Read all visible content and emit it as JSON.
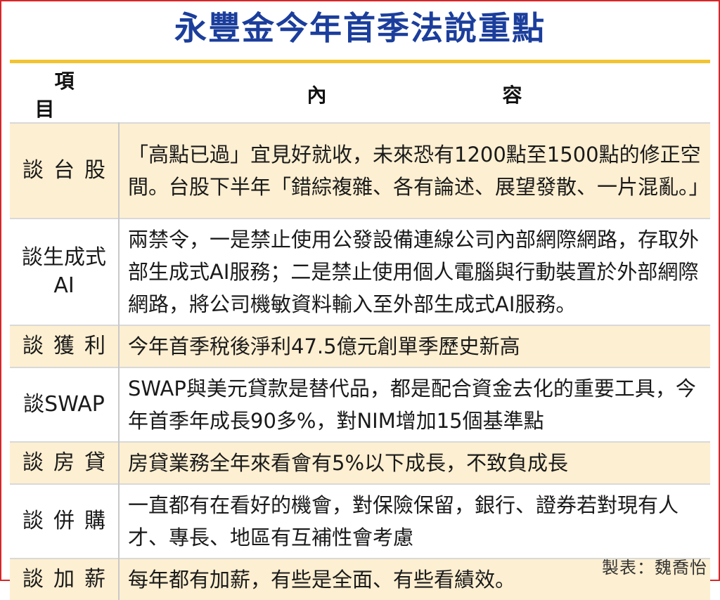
{
  "title": "永豐金今年首季法說重點",
  "header": {
    "item": "項目",
    "content": "內容"
  },
  "rows": [
    {
      "item": "談台股",
      "content": "「高點已過」宜見好就收，未來恐有1200點至1500點的修正空間。台股下半年「錯綜複雜、各有論述、展望發散、一片混亂。」"
    },
    {
      "item_line1": "談生成式",
      "item_line2": "AI",
      "content": "兩禁令，一是禁止使用公發設備連線公司內部網際網路，存取外部生成式AI服務；二是禁止使用個人電腦與行動裝置於外部網際網路，將公司機敏資料輸入至外部生成式AI服務。"
    },
    {
      "item": "談獲利",
      "content": "今年首季稅後淨利47.5億元創單季歷史新高"
    },
    {
      "item": "談SWAP",
      "content": "SWAP與美元貸款是替代品，都是配合資金去化的重要工具，今年首季年成長90多%，對NIM增加15個基準點"
    },
    {
      "item": "談房貸",
      "content": "房貸業務全年來看會有5%以下成長，不致負成長"
    },
    {
      "item": "談併購",
      "content": "一直都有在看好的機會，對保險保留，銀行、證券若對現有人才、專長、地區有互補性會考慮"
    },
    {
      "item": "談加薪",
      "content": "每年都有加薪，有些是全面、有些看績效。"
    }
  ],
  "credit": "製表：魏喬怡",
  "colors": {
    "title": "#1b3e9c",
    "rule": "#f2c431",
    "border": "#d8262a",
    "shade": "#fdefd1"
  }
}
